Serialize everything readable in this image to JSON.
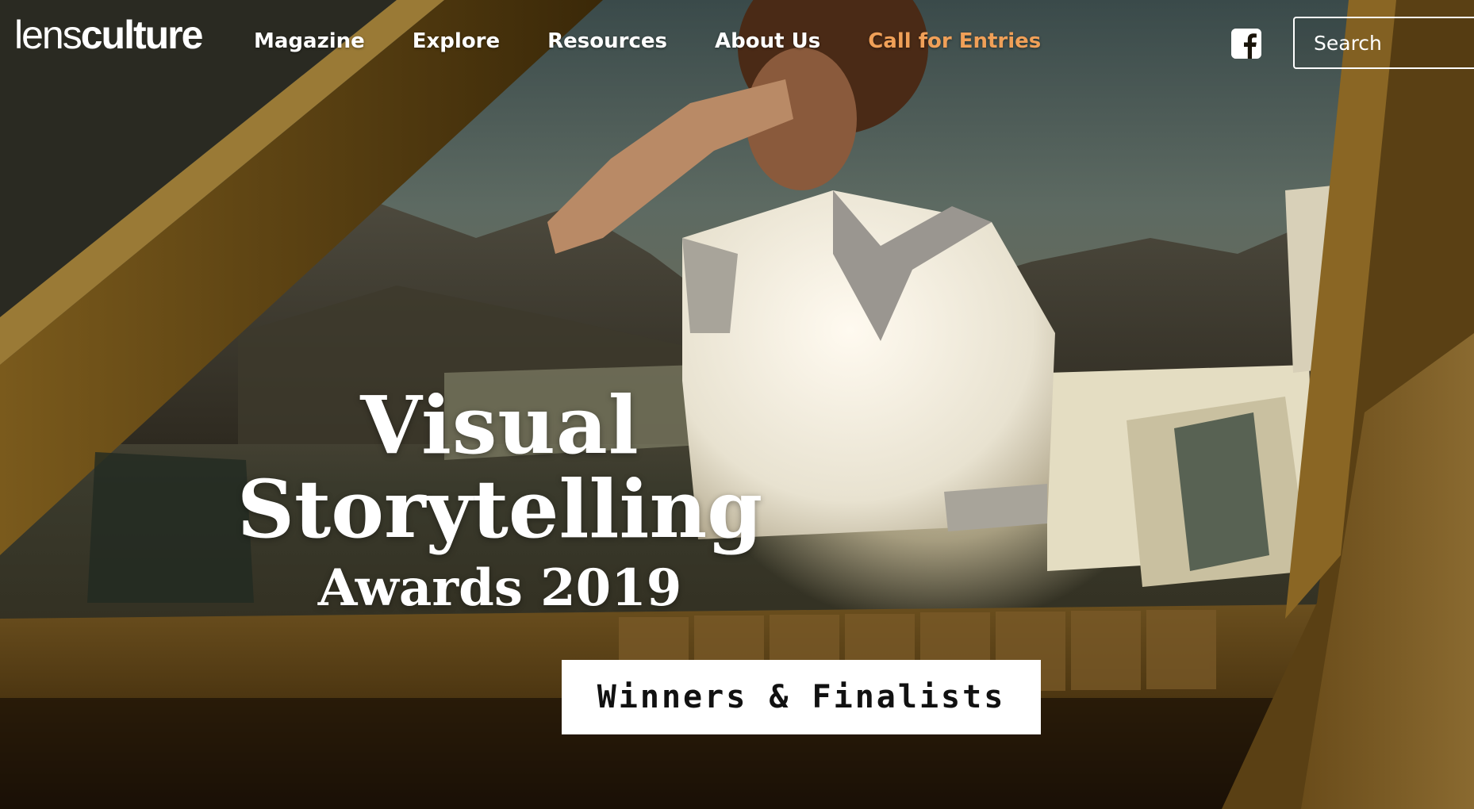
{
  "brand": {
    "logo_part1": "lens",
    "logo_part2": "culture"
  },
  "nav": {
    "items": [
      {
        "label": "Magazine"
      },
      {
        "label": "Explore"
      },
      {
        "label": "Resources"
      },
      {
        "label": "About Us"
      },
      {
        "label": "Call for Entries",
        "color": "#f0a058"
      }
    ]
  },
  "social": {
    "facebook_icon": "facebook-icon"
  },
  "search": {
    "placeholder": "Search"
  },
  "hero": {
    "title_line1": "Visual",
    "title_line2": "Storytelling",
    "title_line3": "Awards 2019",
    "cta_label": "Winners & Finalists"
  },
  "colors": {
    "accent": "#f0a058",
    "cta_bg": "#ffffff",
    "cta_text": "#111111"
  }
}
